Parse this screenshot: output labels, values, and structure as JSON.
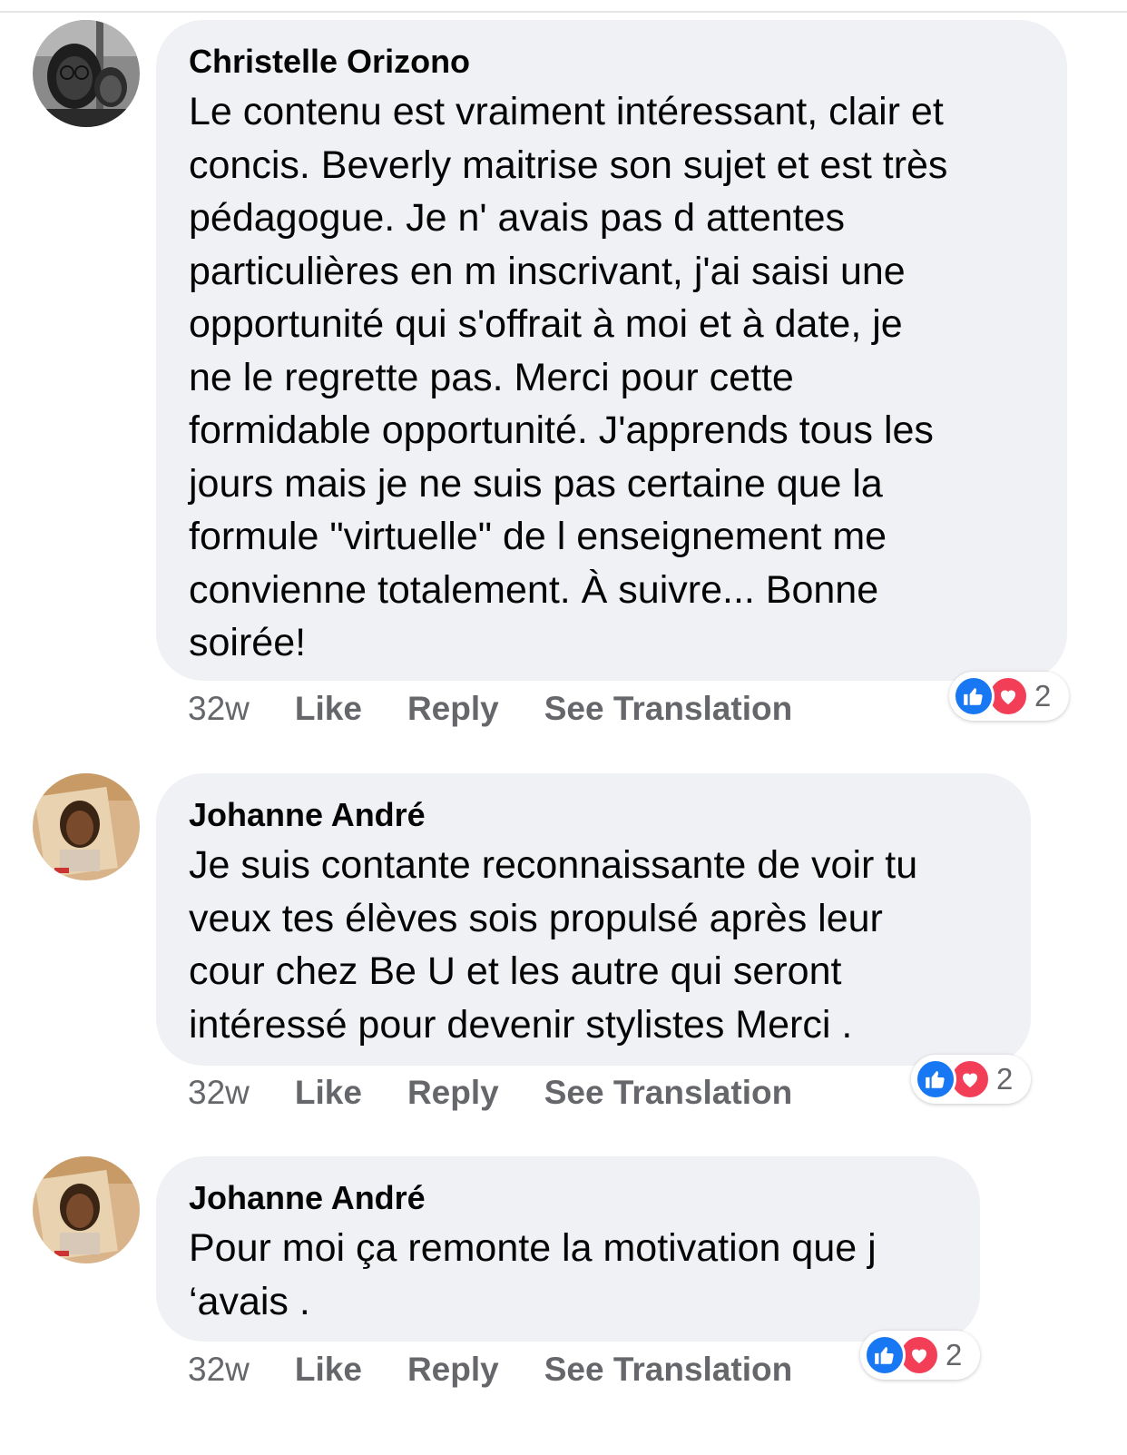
{
  "comments": [
    {
      "author": "Christelle Orizono",
      "text": "Le contenu est vraiment intéressant, clair et\nconcis. Beverly maitrise son sujet et est très\npédagogue. Je n' avais pas d attentes\nparticulières en m inscrivant, j'ai saisi une\nopportunité qui s'offrait à moi et à date, je\nne le regrette pas. Merci pour cette\nformidable opportunité. J'apprends tous les\njours mais je ne suis pas certaine que la\nformule \"virtuelle\" de l enseignement me\nconvienne totalement. À suivre... Bonne\nsoirée!",
      "time": "32w",
      "like": "Like",
      "reply": "Reply",
      "translate": "See Translation",
      "reaction_count": "2",
      "reactions": [
        "like-icon",
        "love-icon"
      ]
    },
    {
      "author": "Johanne André",
      "text": "Je suis contante reconnaissante de voir tu\nveux tes élèves sois propulsé après leur\ncour chez  Be U et les autre qui seront\nintéressé pour devenir stylistes Merci .",
      "time": "32w",
      "like": "Like",
      "reply": "Reply",
      "translate": "See Translation",
      "reaction_count": "2",
      "reactions": [
        "like-icon",
        "love-icon"
      ]
    },
    {
      "author": "Johanne André",
      "text": "Pour moi ça remonte la motivation que j\n‘avais .",
      "time": "32w",
      "like": "Like",
      "reply": "Reply",
      "translate": "See Translation",
      "reaction_count": "2",
      "reactions": [
        "like-icon",
        "love-icon"
      ]
    }
  ],
  "colors": {
    "bubble": "#f0f1f5",
    "meta_text": "#65676b",
    "like_blue": "#1877f2",
    "love_red": "#f33e58"
  }
}
